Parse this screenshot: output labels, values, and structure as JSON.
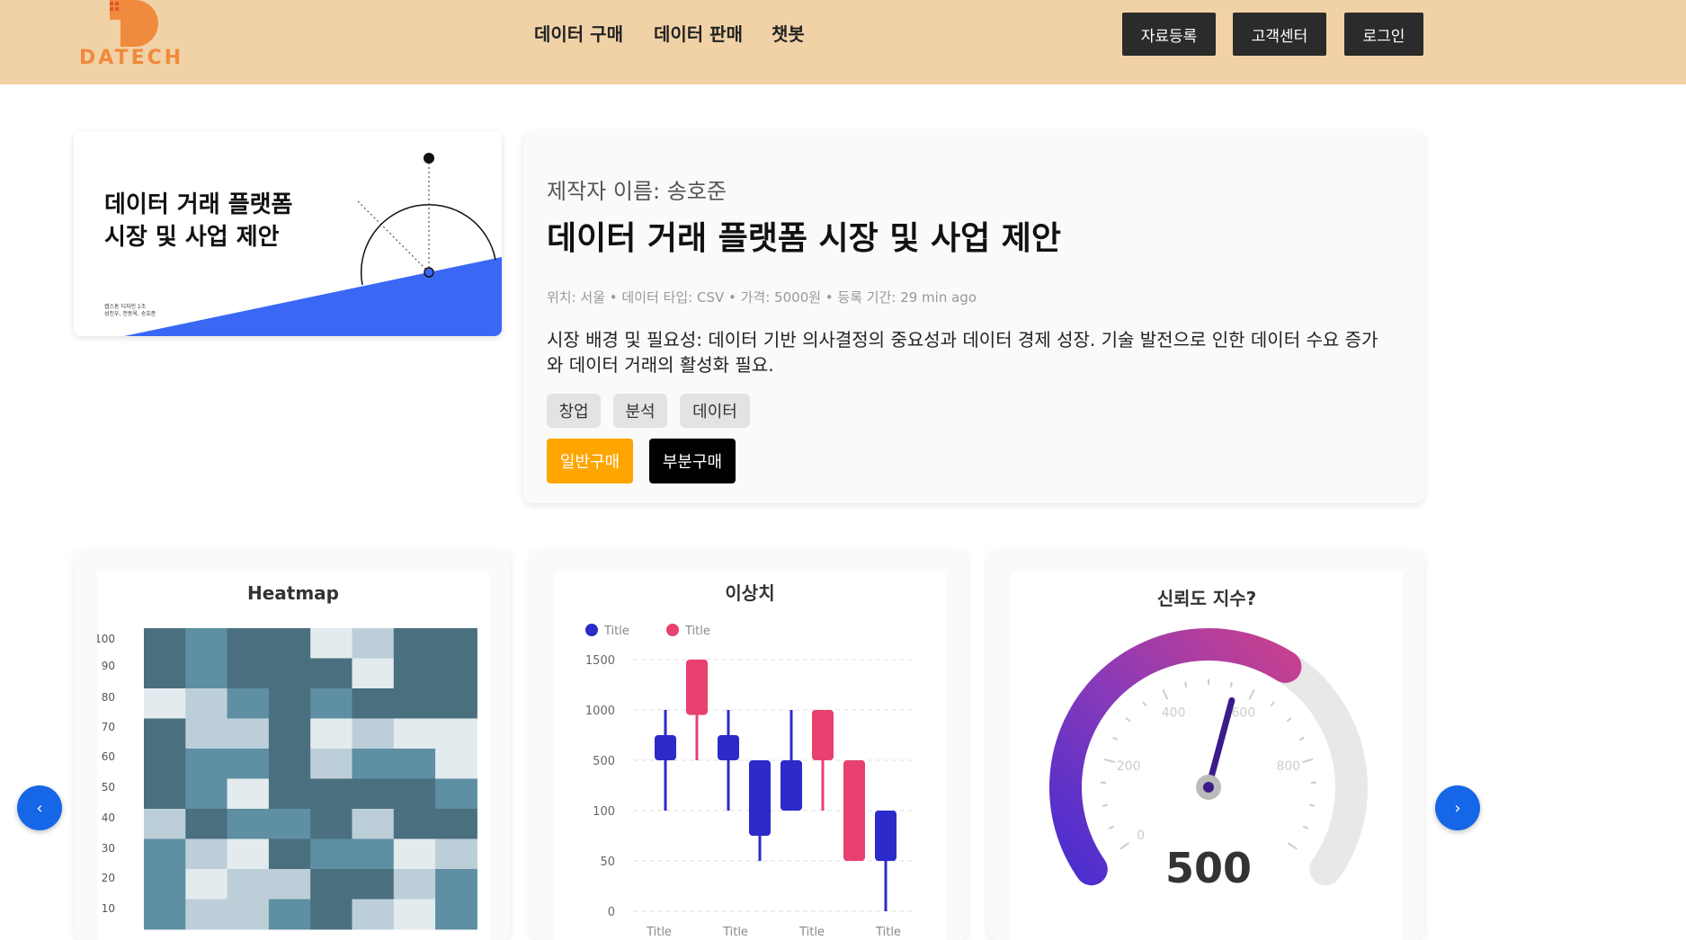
{
  "header": {
    "logo_text": "DATECH",
    "nav": [
      "데이터 구매",
      "데이터 판매",
      "챗봇"
    ],
    "buttons": [
      "자료등록",
      "고객센터",
      "로그인"
    ]
  },
  "thumbnail": {
    "title": "데이터 거래 플랫폼\n시장 및 사업 제안",
    "small_line1": "캡스톤 디자인 1조",
    "small_line2": "성진우, 전동욱, 송호준"
  },
  "product": {
    "author": "제작자 이름: 송호준",
    "title": "데이터 거래 플랫폼 시장 및 사업 제안",
    "meta": "위치: 서울 • 데이터 타입: CSV • 가격: 5000원 • 등록 기간: 29 min ago",
    "description": "시장 배경 및 필요성: 데이터 기반 의사결정의 중요성과 데이터 경제 성장. 기술 발전으로 인한 데이터 수요 증가와 데이터 거래의 활성화 필요.",
    "tags": [
      "창업",
      "분석",
      "데이터"
    ],
    "buy_general": "일반구매",
    "buy_partial": "부분구매"
  },
  "colors": {
    "header_bg": "#f1d2a6",
    "accent_orange": "#ffa500",
    "nav_button": "#2b2b2b",
    "carousel_blue": "#1666e8"
  },
  "carousel": {
    "prev_icon": "‹",
    "next_icon": "›"
  },
  "chart_data": [
    {
      "type": "heatmap",
      "title": "Heatmap",
      "y_ticks": [
        100,
        90,
        80,
        70,
        60,
        50,
        40,
        30,
        20,
        10
      ],
      "levels": [
        [
          3,
          2,
          3,
          3,
          0,
          1,
          3,
          3
        ],
        [
          3,
          2,
          3,
          3,
          3,
          0,
          3,
          3
        ],
        [
          0,
          1,
          2,
          3,
          2,
          3,
          3,
          3
        ],
        [
          3,
          1,
          1,
          3,
          0,
          1,
          0,
          0
        ],
        [
          3,
          2,
          2,
          3,
          1,
          2,
          2,
          0
        ],
        [
          3,
          2,
          0,
          3,
          3,
          3,
          3,
          2
        ],
        [
          1,
          3,
          2,
          2,
          3,
          1,
          3,
          3
        ],
        [
          2,
          1,
          0,
          3,
          2,
          2,
          0,
          1
        ],
        [
          2,
          0,
          1,
          1,
          3,
          3,
          1,
          2
        ],
        [
          2,
          1,
          1,
          2,
          3,
          1,
          0,
          2
        ]
      ],
      "palette": [
        "#e3ebee",
        "#bccfd9",
        "#5e8fa3",
        "#4a6f7f"
      ]
    },
    {
      "type": "candlestick",
      "title": "이상치",
      "series": [
        {
          "name": "Title",
          "color": "#2c2ac9"
        },
        {
          "name": "Title",
          "color": "#e8416f"
        }
      ],
      "y_ticks": [
        "1500",
        "1000",
        "500",
        "100",
        "50",
        "0"
      ],
      "x_ticks": [
        "Title",
        "Title",
        "Title",
        "Title"
      ],
      "candles": [
        {
          "series": 0,
          "low": 100,
          "open": 500,
          "close": 750,
          "high": 1000
        },
        {
          "series": 1,
          "low": 500,
          "open": 950,
          "close": 1500,
          "high": 1500
        },
        {
          "series": 0,
          "low": 100,
          "open": 500,
          "close": 750,
          "high": 1000
        },
        {
          "series": 0,
          "low": 50,
          "open": 75,
          "close": 500,
          "high": 500
        },
        {
          "series": 0,
          "low": 100,
          "open": 100,
          "close": 500,
          "high": 1000
        },
        {
          "series": 1,
          "low": 100,
          "open": 500,
          "close": 1000,
          "high": 1000
        },
        {
          "series": 1,
          "low": 50,
          "open": 50,
          "close": 500,
          "high": 500
        },
        {
          "series": 0,
          "low": 0,
          "open": 50,
          "close": 100,
          "high": 100
        }
      ]
    },
    {
      "type": "gauge",
      "title": "신뢰도 지수?",
      "value": 500,
      "display_value": "500",
      "min": 0,
      "max": 1000,
      "labels": [
        "0",
        "200",
        "400",
        "600",
        "800"
      ]
    }
  ]
}
